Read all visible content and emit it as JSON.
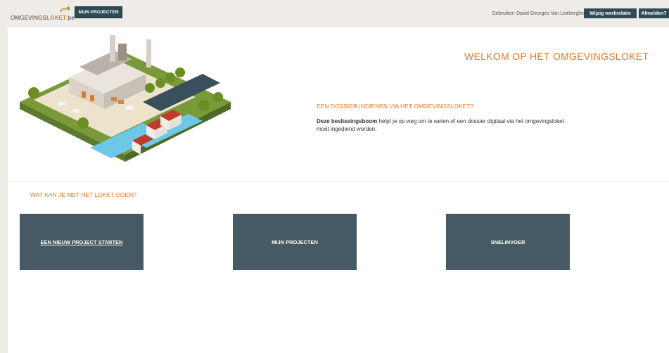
{
  "header": {
    "logo_prefix": "OMGEVINGS",
    "logo_accent": "LOKET",
    "logo_suffix": ".be",
    "nav_button": "MIJN PROJECTEN",
    "user_label": "Gebruiker: David Georges Van Leirberghe",
    "change_relation_button": "Wijzig werkrelatie",
    "logout_button": "Afmelden?"
  },
  "hero": {
    "welcome_title": "WELKOM OP HET OMGEVINGSLOKET",
    "dossier_title": "EEN DOSSIER INDIENEN VIA HET OMGEVINGSLOKET?",
    "dossier_link": "Deze beslissingsboom",
    "dossier_text": " helpt je op weg om te weten of een dossier digitaal via het omgevingsloket moet ingediend worden."
  },
  "actions": {
    "section_title": "WAT KAN JE MET HET LOKET DOEN?",
    "tiles": [
      {
        "label": "EEN NIEUW PROJECT STARTEN"
      },
      {
        "label": "MIJN PROJECTEN"
      },
      {
        "label": "SNELINVOER"
      }
    ]
  },
  "colors": {
    "accent": "#e87722",
    "tile_bg": "#455a64",
    "topbar_bg": "#efebe6",
    "button_bg": "#2e4a57"
  }
}
